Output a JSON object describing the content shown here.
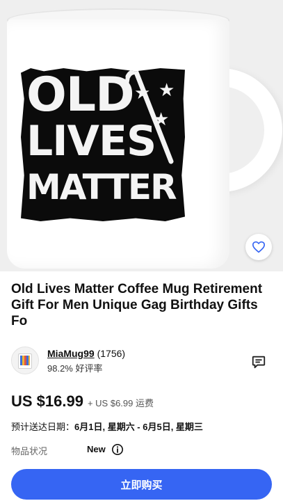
{
  "product_image": {
    "print_lines": [
      "OLD",
      "LIVES",
      "MATTER"
    ],
    "favorite_icon": "heart-outline-icon"
  },
  "title": "Old Lives Matter Coffee Mug Retirement Gift For Men Unique Gag Birthday Gifts Fo",
  "seller": {
    "name": "MiaMug99",
    "feedback_count": "(1756)",
    "rating": "98.2% 好评率",
    "message_icon": "message-icon"
  },
  "price": {
    "amount": "US $16.99",
    "shipping": "+ US $6.99 运费"
  },
  "delivery": {
    "label": "预计送达日期：",
    "range": "6月1日, 星期六 - 6月5日, 星期三"
  },
  "condition": {
    "label": "物品状况",
    "value": "New"
  },
  "buy_button": {
    "label": "立即购买"
  },
  "colors": {
    "accent": "#3665f3",
    "text": "#111111"
  }
}
